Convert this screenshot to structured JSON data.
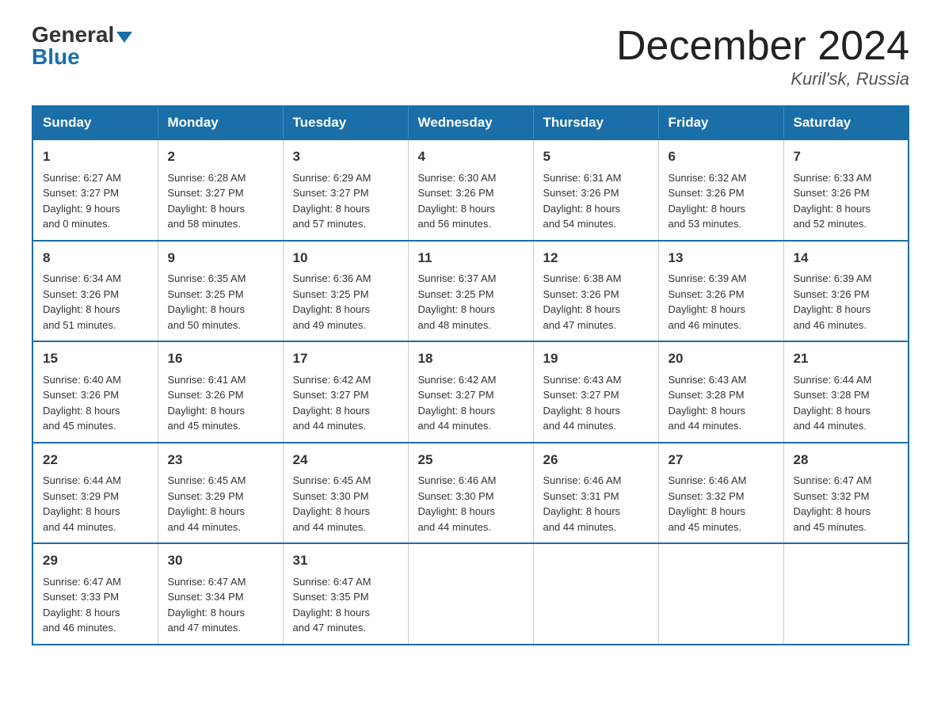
{
  "header": {
    "logo_general": "General",
    "logo_blue": "Blue",
    "month_title": "December 2024",
    "location": "Kuril'sk, Russia"
  },
  "days_of_week": [
    "Sunday",
    "Monday",
    "Tuesday",
    "Wednesday",
    "Thursday",
    "Friday",
    "Saturday"
  ],
  "weeks": [
    [
      {
        "day": "1",
        "sunrise": "6:27 AM",
        "sunset": "3:27 PM",
        "daylight": "9 hours and 0 minutes."
      },
      {
        "day": "2",
        "sunrise": "6:28 AM",
        "sunset": "3:27 PM",
        "daylight": "8 hours and 58 minutes."
      },
      {
        "day": "3",
        "sunrise": "6:29 AM",
        "sunset": "3:27 PM",
        "daylight": "8 hours and 57 minutes."
      },
      {
        "day": "4",
        "sunrise": "6:30 AM",
        "sunset": "3:26 PM",
        "daylight": "8 hours and 56 minutes."
      },
      {
        "day": "5",
        "sunrise": "6:31 AM",
        "sunset": "3:26 PM",
        "daylight": "8 hours and 54 minutes."
      },
      {
        "day": "6",
        "sunrise": "6:32 AM",
        "sunset": "3:26 PM",
        "daylight": "8 hours and 53 minutes."
      },
      {
        "day": "7",
        "sunrise": "6:33 AM",
        "sunset": "3:26 PM",
        "daylight": "8 hours and 52 minutes."
      }
    ],
    [
      {
        "day": "8",
        "sunrise": "6:34 AM",
        "sunset": "3:26 PM",
        "daylight": "8 hours and 51 minutes."
      },
      {
        "day": "9",
        "sunrise": "6:35 AM",
        "sunset": "3:25 PM",
        "daylight": "8 hours and 50 minutes."
      },
      {
        "day": "10",
        "sunrise": "6:36 AM",
        "sunset": "3:25 PM",
        "daylight": "8 hours and 49 minutes."
      },
      {
        "day": "11",
        "sunrise": "6:37 AM",
        "sunset": "3:25 PM",
        "daylight": "8 hours and 48 minutes."
      },
      {
        "day": "12",
        "sunrise": "6:38 AM",
        "sunset": "3:26 PM",
        "daylight": "8 hours and 47 minutes."
      },
      {
        "day": "13",
        "sunrise": "6:39 AM",
        "sunset": "3:26 PM",
        "daylight": "8 hours and 46 minutes."
      },
      {
        "day": "14",
        "sunrise": "6:39 AM",
        "sunset": "3:26 PM",
        "daylight": "8 hours and 46 minutes."
      }
    ],
    [
      {
        "day": "15",
        "sunrise": "6:40 AM",
        "sunset": "3:26 PM",
        "daylight": "8 hours and 45 minutes."
      },
      {
        "day": "16",
        "sunrise": "6:41 AM",
        "sunset": "3:26 PM",
        "daylight": "8 hours and 45 minutes."
      },
      {
        "day": "17",
        "sunrise": "6:42 AM",
        "sunset": "3:27 PM",
        "daylight": "8 hours and 44 minutes."
      },
      {
        "day": "18",
        "sunrise": "6:42 AM",
        "sunset": "3:27 PM",
        "daylight": "8 hours and 44 minutes."
      },
      {
        "day": "19",
        "sunrise": "6:43 AM",
        "sunset": "3:27 PM",
        "daylight": "8 hours and 44 minutes."
      },
      {
        "day": "20",
        "sunrise": "6:43 AM",
        "sunset": "3:28 PM",
        "daylight": "8 hours and 44 minutes."
      },
      {
        "day": "21",
        "sunrise": "6:44 AM",
        "sunset": "3:28 PM",
        "daylight": "8 hours and 44 minutes."
      }
    ],
    [
      {
        "day": "22",
        "sunrise": "6:44 AM",
        "sunset": "3:29 PM",
        "daylight": "8 hours and 44 minutes."
      },
      {
        "day": "23",
        "sunrise": "6:45 AM",
        "sunset": "3:29 PM",
        "daylight": "8 hours and 44 minutes."
      },
      {
        "day": "24",
        "sunrise": "6:45 AM",
        "sunset": "3:30 PM",
        "daylight": "8 hours and 44 minutes."
      },
      {
        "day": "25",
        "sunrise": "6:46 AM",
        "sunset": "3:30 PM",
        "daylight": "8 hours and 44 minutes."
      },
      {
        "day": "26",
        "sunrise": "6:46 AM",
        "sunset": "3:31 PM",
        "daylight": "8 hours and 44 minutes."
      },
      {
        "day": "27",
        "sunrise": "6:46 AM",
        "sunset": "3:32 PM",
        "daylight": "8 hours and 45 minutes."
      },
      {
        "day": "28",
        "sunrise": "6:47 AM",
        "sunset": "3:32 PM",
        "daylight": "8 hours and 45 minutes."
      }
    ],
    [
      {
        "day": "29",
        "sunrise": "6:47 AM",
        "sunset": "3:33 PM",
        "daylight": "8 hours and 46 minutes."
      },
      {
        "day": "30",
        "sunrise": "6:47 AM",
        "sunset": "3:34 PM",
        "daylight": "8 hours and 47 minutes."
      },
      {
        "day": "31",
        "sunrise": "6:47 AM",
        "sunset": "3:35 PM",
        "daylight": "8 hours and 47 minutes."
      },
      null,
      null,
      null,
      null
    ]
  ],
  "labels": {
    "sunrise": "Sunrise:",
    "sunset": "Sunset:",
    "daylight": "Daylight:"
  }
}
